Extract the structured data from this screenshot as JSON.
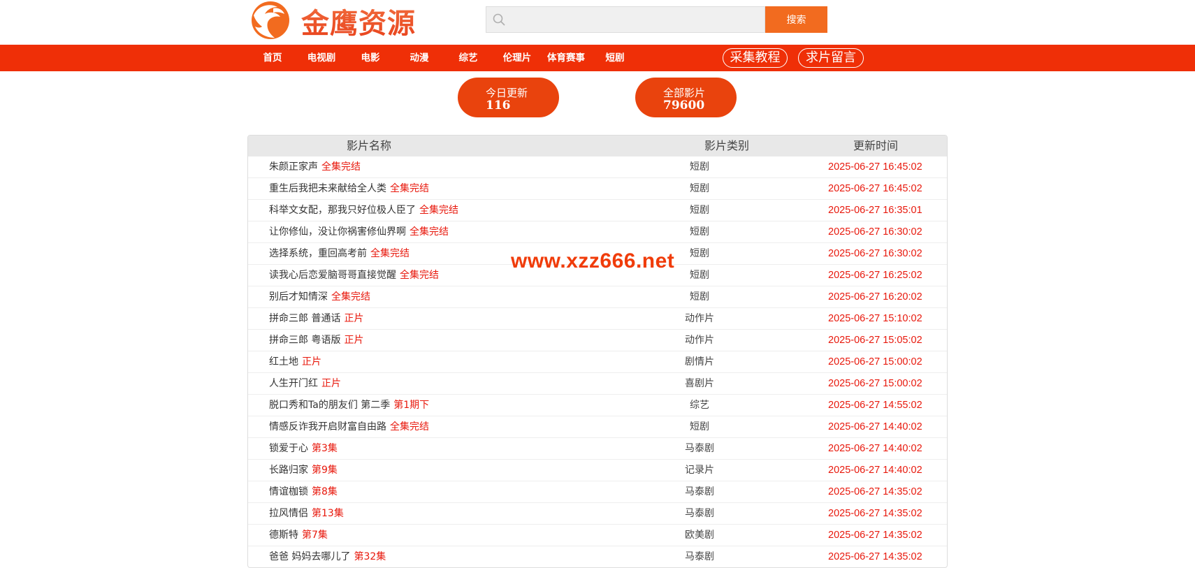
{
  "brand": {
    "name": "金鹰资源"
  },
  "search": {
    "placeholder": "",
    "button_label": "搜索"
  },
  "nav": {
    "items": [
      "首页",
      "电视剧",
      "电影",
      "动漫",
      "综艺",
      "伦理片",
      "体育赛事",
      "短剧"
    ],
    "pills": [
      "采集教程",
      "求片留言"
    ]
  },
  "stats": {
    "today": {
      "label": "今日更新",
      "value": "116"
    },
    "total": {
      "label": "全部影片",
      "value": "79600"
    }
  },
  "table": {
    "headers": [
      "影片名称",
      "影片类别",
      "更新时间"
    ],
    "rows": [
      {
        "name": "朱颜正家声",
        "status": "全集完结",
        "type": "短剧",
        "time": "2025-06-27 16:45:02"
      },
      {
        "name": "重生后我把未来献给全人类",
        "status": "全集完结",
        "type": "短剧",
        "time": "2025-06-27 16:45:02"
      },
      {
        "name": "科举文女配，那我只好位极人臣了",
        "status": "全集完结",
        "type": "短剧",
        "time": "2025-06-27 16:35:01"
      },
      {
        "name": "让你修仙，没让你祸害修仙界啊",
        "status": "全集完结",
        "type": "短剧",
        "time": "2025-06-27 16:30:02"
      },
      {
        "name": "选择系统，重回高考前",
        "status": "全集完结",
        "type": "短剧",
        "time": "2025-06-27 16:30:02"
      },
      {
        "name": "读我心后恋爱脑哥哥直接觉醒",
        "status": "全集完结",
        "type": "短剧",
        "time": "2025-06-27 16:25:02"
      },
      {
        "name": "别后才知情深",
        "status": "全集完结",
        "type": "短剧",
        "time": "2025-06-27 16:20:02"
      },
      {
        "name": "拼命三郎 普通话",
        "status": "正片",
        "type": "动作片",
        "time": "2025-06-27 15:10:02"
      },
      {
        "name": "拼命三郎 粤语版",
        "status": "正片",
        "type": "动作片",
        "time": "2025-06-27 15:05:02"
      },
      {
        "name": "红土地",
        "status": "正片",
        "type": "剧情片",
        "time": "2025-06-27 15:00:02"
      },
      {
        "name": "人生开门红",
        "status": "正片",
        "type": "喜剧片",
        "time": "2025-06-27 15:00:02"
      },
      {
        "name": "脱口秀和Ta的朋友们 第二季",
        "status": "第1期下",
        "type": "综艺",
        "time": "2025-06-27 14:55:02"
      },
      {
        "name": "情感反诈我开启财富自由路",
        "status": "全集完结",
        "type": "短剧",
        "time": "2025-06-27 14:40:02"
      },
      {
        "name": "锁爱于心",
        "status": "第3集",
        "type": "马泰剧",
        "time": "2025-06-27 14:40:02"
      },
      {
        "name": "长路归家",
        "status": "第9集",
        "type": "记录片",
        "time": "2025-06-27 14:40:02"
      },
      {
        "name": "情谊枷锁",
        "status": "第8集",
        "type": "马泰剧",
        "time": "2025-06-27 14:35:02"
      },
      {
        "name": "拉风情侣",
        "status": "第13集",
        "type": "马泰剧",
        "time": "2025-06-27 14:35:02"
      },
      {
        "name": "德斯特",
        "status": "第7集",
        "type": "欧美剧",
        "time": "2025-06-27 14:35:02"
      },
      {
        "name": "爸爸 妈妈去哪儿了",
        "status": "第32集",
        "type": "马泰剧",
        "time": "2025-06-27 14:35:02"
      }
    ]
  },
  "watermark": "www.xzz666.net",
  "colors": {
    "nav_bg": "#ef2f07",
    "accent": "#f26b1f",
    "status_red": "#e8180c"
  }
}
